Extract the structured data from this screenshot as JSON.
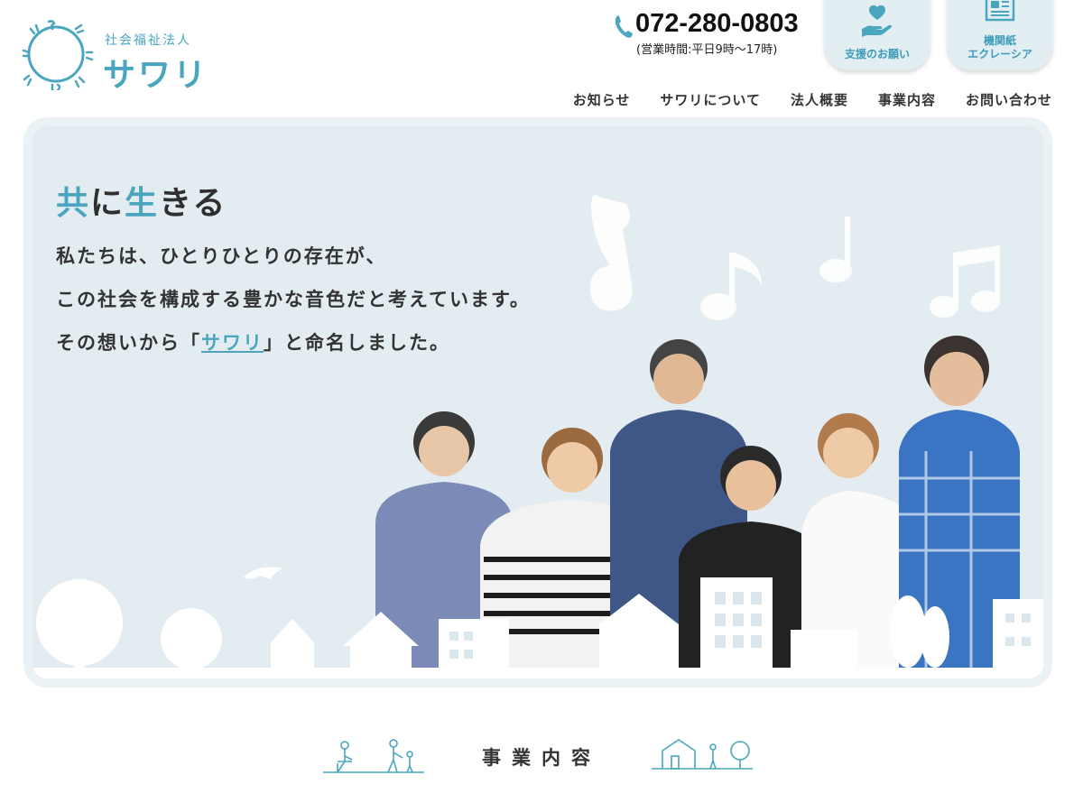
{
  "header": {
    "logo": {
      "subtitle": "社会福祉法人",
      "name": "サワリ"
    },
    "phone": {
      "number": "072-280-0803",
      "hours": "(営業時間:平日9時〜17時)"
    },
    "buttons": [
      {
        "label": "支援のお願い",
        "icon": "heart-hand-icon"
      },
      {
        "label_line1": "機関紙",
        "label_line2": "エクレーシア",
        "icon": "newspaper-icon"
      }
    ],
    "nav": [
      "お知らせ",
      "サワリについて",
      "法人概要",
      "事業内容",
      "お問い合わせ"
    ]
  },
  "hero": {
    "title_parts": [
      "共",
      "に",
      "生",
      "きる"
    ],
    "line1": "私たちは、ひとりひとりの存在が、",
    "line2": "この社会を構成する豊かな音色だと考えています。",
    "line3_before": "その想いから「",
    "line3_link": "サワリ",
    "line3_after": "」と命名しました。"
  },
  "section": {
    "title": "事業内容"
  },
  "colors": {
    "accent": "#4aa6bf",
    "hero_bg": "#e3ecf0",
    "text": "#2f2f2f"
  }
}
